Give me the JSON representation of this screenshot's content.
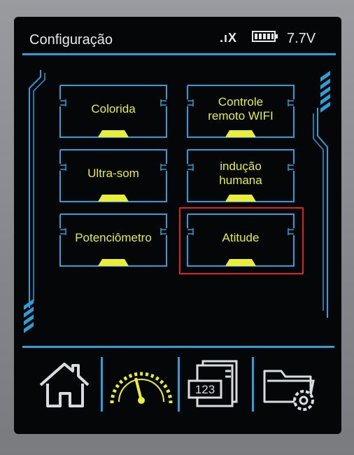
{
  "header": {
    "title": "Configuração",
    "signal_text": ".ıX",
    "voltage": "7.7V",
    "battery_icon": "battery-icon"
  },
  "tiles": [
    {
      "label": "Colorida"
    },
    {
      "label": "Controle\nremoto WIFI"
    },
    {
      "label": "Ultra-som"
    },
    {
      "label": "indução\nhumana"
    },
    {
      "label": "Potenciômetro"
    },
    {
      "label": "Atitude"
    }
  ],
  "selected_tile": "Atitude",
  "nav": [
    {
      "icon": "home-icon"
    },
    {
      "icon": "speedometer-icon"
    },
    {
      "icon": "numeric-display-icon",
      "text": "123"
    },
    {
      "icon": "folder-settings-icon"
    }
  ],
  "colors": {
    "accent": "#2d9fd8",
    "label": "#e8ee3a",
    "highlight": "#d8242a",
    "screen": "#050608"
  }
}
